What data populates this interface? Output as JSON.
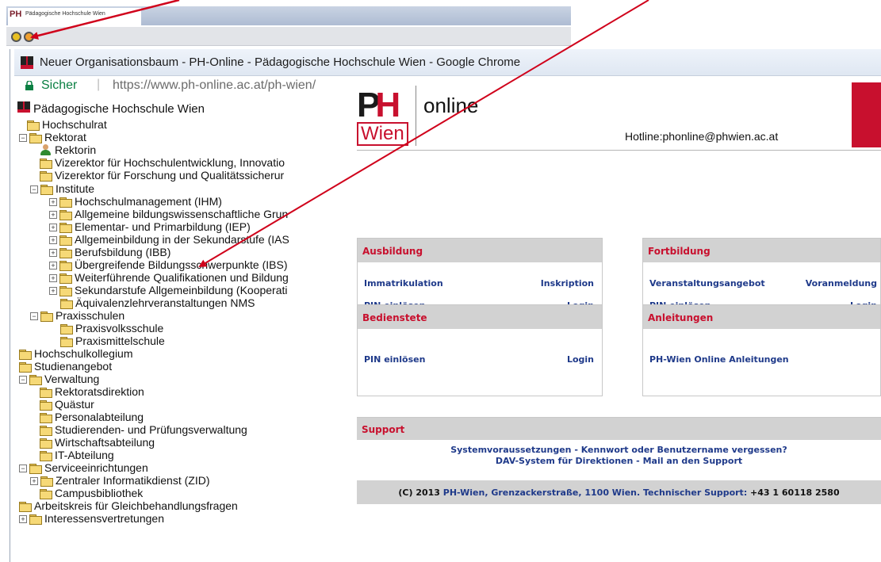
{
  "taskbar": {
    "tab_logo": "PH",
    "tab_title": "Pädagogische Hochschule Wien"
  },
  "window": {
    "logo": "PH",
    "title": "Neuer Organisationsbaum - PH-Online - Pädagogische Hochschule Wien - Google Chrome"
  },
  "address": {
    "secure_label": "Sicher",
    "separator": "|",
    "url": "https://www.ph-online.ac.at/ph-wien/"
  },
  "tree": {
    "root_label": "Pädagogische Hochschule Wien",
    "items": [
      {
        "label": "Hochschulrat",
        "toggle": "",
        "icon": "folder"
      },
      {
        "label": "Rektorat",
        "toggle": "−",
        "icon": "folder"
      },
      {
        "label": "Rektorin",
        "toggle": "",
        "icon": "person"
      },
      {
        "label": "Vizerektor für Hochschulentwicklung, Innovatio",
        "toggle": "",
        "icon": "folder"
      },
      {
        "label": "Vizerektor für Forschung und Qualitätssicherur",
        "toggle": "",
        "icon": "folder"
      },
      {
        "label": "Institute",
        "toggle": "−",
        "icon": "folder"
      },
      {
        "label": "Hochschulmanagement (IHM)",
        "toggle": "+",
        "icon": "folder"
      },
      {
        "label": "Allgemeine bildungswissenschaftliche Grun",
        "toggle": "+",
        "icon": "folder"
      },
      {
        "label": "Elementar- und Primarbildung (IEP)",
        "toggle": "+",
        "icon": "folder"
      },
      {
        "label": "Allgemeinbildung in der Sekundarstufe (IAS",
        "toggle": "+",
        "icon": "folder"
      },
      {
        "label": "Berufsbildung (IBB)",
        "toggle": "+",
        "icon": "folder"
      },
      {
        "label": "Übergreifende Bildungsschwerpunkte (IBS)",
        "toggle": "+",
        "icon": "folder"
      },
      {
        "label": "Weiterführende Qualifikationen und Bildung",
        "toggle": "+",
        "icon": "folder"
      },
      {
        "label": "Sekundarstufe Allgemeinbildung (Kooperati",
        "toggle": "+",
        "icon": "folder"
      },
      {
        "label": "Äquivalenzlehrveranstaltungen NMS",
        "toggle": "",
        "icon": "folder"
      },
      {
        "label": "Praxisschulen",
        "toggle": "−",
        "icon": "folder"
      },
      {
        "label": "Praxisvolksschule",
        "toggle": "",
        "icon": "folder"
      },
      {
        "label": "Praxismittelschule",
        "toggle": "",
        "icon": "folder"
      },
      {
        "label": "Hochschulkollegium",
        "toggle": "",
        "icon": "folder"
      },
      {
        "label": "Studienangebot",
        "toggle": "",
        "icon": "folder"
      },
      {
        "label": "Verwaltung",
        "toggle": "−",
        "icon": "folder"
      },
      {
        "label": "Rektoratsdirektion",
        "toggle": "",
        "icon": "folder"
      },
      {
        "label": "Quästur",
        "toggle": "",
        "icon": "folder"
      },
      {
        "label": "Personalabteilung",
        "toggle": "",
        "icon": "folder"
      },
      {
        "label": "Studierenden- und Prüfungsverwaltung",
        "toggle": "",
        "icon": "folder"
      },
      {
        "label": "Wirtschaftsabteilung",
        "toggle": "",
        "icon": "folder"
      },
      {
        "label": "IT-Abteilung",
        "toggle": "",
        "icon": "folder"
      },
      {
        "label": "Serviceeinrichtungen",
        "toggle": "−",
        "icon": "folder"
      },
      {
        "label": "Zentraler Informatikdienst (ZID)",
        "toggle": "+",
        "icon": "folder"
      },
      {
        "label": "Campusbibliothek",
        "toggle": "",
        "icon": "folder"
      },
      {
        "label": "Arbeitskreis für Gleichbehandlungsfragen",
        "toggle": "",
        "icon": "folder"
      },
      {
        "label": "Interessensvertretungen",
        "toggle": "+",
        "icon": "folder"
      }
    ]
  },
  "portal": {
    "brand_ph": "PH",
    "brand_wien": "Wien",
    "online": "online",
    "hotline": "Hotline:phonline@phwien.ac.at",
    "ausbildung": {
      "title": "Ausbildung",
      "link1": "Immatrikulation",
      "link2": "Inskription",
      "link3": "PIN einlösen",
      "link4": "Login"
    },
    "fortbildung": {
      "title": "Fortbildung",
      "link1": "Veranstaltungsangebot",
      "link2": "Voranmeldung",
      "link3": "PIN einlösen",
      "link4": "Login"
    },
    "bedienstete": {
      "title": "Bedienstete",
      "link1": "PIN einlösen",
      "link2": "Login"
    },
    "anleitungen": {
      "title": "Anleitungen",
      "link1": "PH-Wien Online Anleitungen"
    },
    "support": {
      "title": "Support",
      "line1": "Systemvoraussetzungen - Kennwort oder Benutzername vergessen?",
      "line2": "DAV-System für Direktionen - Mail an den Support"
    },
    "footer": {
      "prefix": "(C) 2013 ",
      "org": "PH-Wien, Grenzackerstraße, 1100 Wien. Technischer Support:",
      "phone": " +43 1 60118 2580"
    }
  },
  "colors": {
    "brand_red": "#c8102e",
    "link_blue": "#1f3a8a",
    "annotation_arrow": "#d0021b"
  }
}
